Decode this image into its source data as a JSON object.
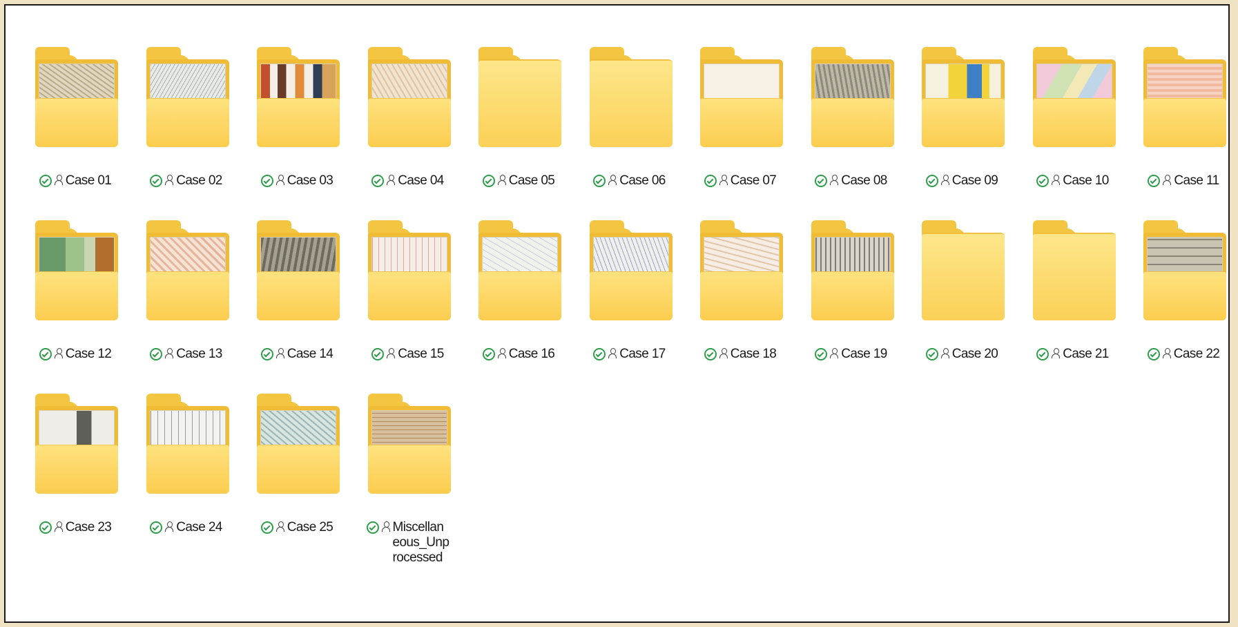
{
  "folders": [
    {
      "label": "Case 01",
      "thumb": "t-map1"
    },
    {
      "label": "Case 02",
      "thumb": "t-map2"
    },
    {
      "label": "Case 03",
      "thumb": "t-collage"
    },
    {
      "label": "Case 04",
      "thumb": "t-map4"
    },
    {
      "label": "Case 05",
      "thumb": "empty"
    },
    {
      "label": "Case 06",
      "thumb": "empty"
    },
    {
      "label": "Case 07",
      "thumb": "t-plain"
    },
    {
      "label": "Case 08",
      "thumb": "t-gray"
    },
    {
      "label": "Case 09",
      "thumb": "t-yellow"
    },
    {
      "label": "Case 10",
      "thumb": "t-pastel"
    },
    {
      "label": "Case 11",
      "thumb": "t-pink"
    },
    {
      "label": "Case 12",
      "thumb": "t-green"
    },
    {
      "label": "Case 13",
      "thumb": "t-orange"
    },
    {
      "label": "Case 14",
      "thumb": "t-dark"
    },
    {
      "label": "Case 15",
      "thumb": "t-lines"
    },
    {
      "label": "Case 16",
      "thumb": "t-light"
    },
    {
      "label": "Case 17",
      "thumb": "t-road"
    },
    {
      "label": "Case 18",
      "thumb": "t-tan"
    },
    {
      "label": "Case 19",
      "thumb": "t-city"
    },
    {
      "label": "Case 20",
      "thumb": "sheet"
    },
    {
      "label": "Case 21",
      "thumb": "sheet"
    },
    {
      "label": "Case 22",
      "thumb": "t-grid"
    },
    {
      "label": "Case 23",
      "thumb": "t-doc"
    },
    {
      "label": "Case 24",
      "thumb": "t-sketch"
    },
    {
      "label": "Case 25",
      "thumb": "t-blue"
    },
    {
      "label": "Miscellaneous_Unprocessed",
      "thumb": "t-brown"
    }
  ],
  "status_icon": "sync-available-icon",
  "shared_icon": "person-icon",
  "colors": {
    "folder": "#f4c540",
    "status_green": "#2e9e4a",
    "frame_border": "#1a1a1a",
    "outer_background": "#f0e3c4"
  }
}
